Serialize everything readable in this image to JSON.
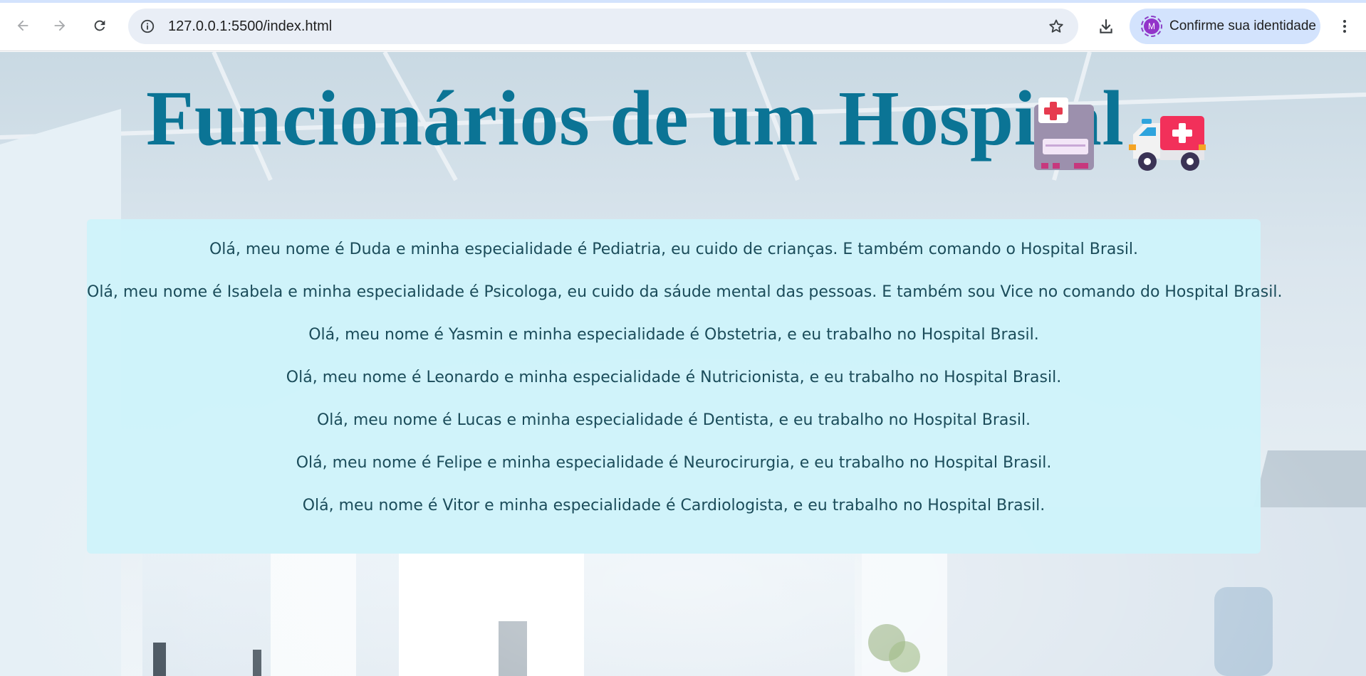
{
  "browser": {
    "url": "127.0.0.1:5500/index.html",
    "profile": {
      "initial": "M",
      "label": "Confirme sua identidade"
    },
    "icons": [
      "back-arrow-icon",
      "forward-arrow-icon",
      "reload-icon",
      "site-info-icon",
      "bookmark-star-icon",
      "download-icon",
      "more-menu-icon"
    ]
  },
  "page": {
    "title": "Funcionários de um Hospital",
    "title_icons": [
      "hospital-building-icon",
      "ambulance-icon"
    ],
    "colors": {
      "title": "#0b7495",
      "card_background": "#cef3fa",
      "text": "#1b4c5a"
    },
    "employees": [
      "Olá, meu nome é Duda e minha especialidade é Pediatria, eu cuido de crianças. E também comando o Hospital Brasil.",
      "Olá, meu nome é Isabela e minha especialidade é Psicologa, eu cuido da sáude mental das pessoas. E também sou Vice no comando do Hospital Brasil.",
      "Olá, meu nome é Yasmin e minha especialidade é Obstetria, e eu trabalho no Hospital Brasil.",
      "Olá, meu nome é Leonardo e minha especialidade é Nutricionista, e eu trabalho no Hospital Brasil.",
      "Olá, meu nome é Lucas e minha especialidade é Dentista, e eu trabalho no Hospital Brasil.",
      "Olá, meu nome é Felipe e minha especialidade é Neurocirurgia, e eu trabalho no Hospital Brasil.",
      "Olá, meu nome é Vitor e minha especialidade é Cardiologista, e eu trabalho no Hospital Brasil."
    ]
  }
}
